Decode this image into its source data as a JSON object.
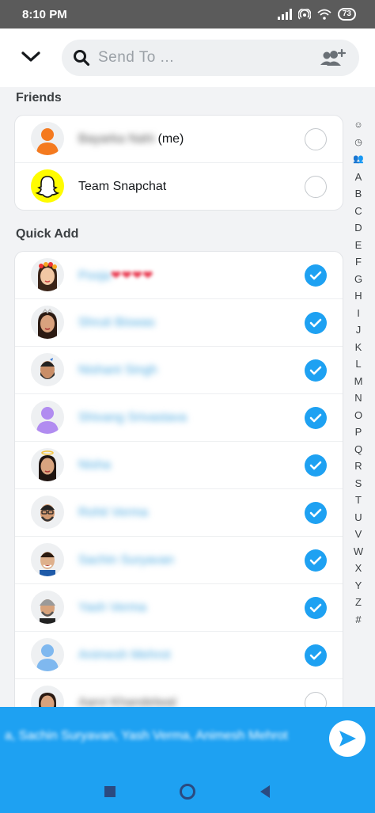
{
  "status_bar": {
    "time": "8:10 PM",
    "battery": "73"
  },
  "header": {
    "search_placeholder": "Send To ..."
  },
  "friends": {
    "title": "Friends",
    "items": [
      {
        "name": "Bayarka Nahi",
        "suffix": "(me)",
        "blurred": true,
        "checked": false,
        "avatar": "orange-silhouette"
      },
      {
        "name": "Team Snapchat",
        "suffix": "",
        "blurred": false,
        "checked": false,
        "avatar": "snapchat-logo"
      }
    ]
  },
  "quick_add": {
    "title": "Quick Add",
    "items": [
      {
        "name": "Pooja",
        "decoration": "❤❤❤❤",
        "checked": true,
        "avatar": "bitmoji-girl-flower-crown"
      },
      {
        "name": "Shruti Biswas",
        "checked": true,
        "avatar": "bitmoji-girl-tiara"
      },
      {
        "name": "Nishant Singh",
        "checked": true,
        "avatar": "bitmoji-boy-beard"
      },
      {
        "name": "Shivang Srivastava",
        "checked": true,
        "avatar": "purple-silhouette"
      },
      {
        "name": "Nisha",
        "checked": true,
        "avatar": "bitmoji-girl-halo"
      },
      {
        "name": "Rohit Verma",
        "checked": true,
        "avatar": "bitmoji-boy-glasses"
      },
      {
        "name": "Sachin Suryavan",
        "checked": true,
        "avatar": "bitmoji-boy-smile"
      },
      {
        "name": "Yash Verma",
        "checked": true,
        "avatar": "bitmoji-boy-grey-hair"
      },
      {
        "name": "Animesh Mehrot",
        "checked": true,
        "avatar": "blue-silhouette"
      },
      {
        "name": "Aarvi Khandelwal",
        "checked": false,
        "avatar": "bitmoji-girl-dark-hair"
      }
    ]
  },
  "index_bar": [
    "☺",
    "◷",
    "👥",
    "A",
    "B",
    "C",
    "D",
    "E",
    "F",
    "G",
    "H",
    "I",
    "J",
    "K",
    "L",
    "M",
    "N",
    "O",
    "P",
    "Q",
    "R",
    "S",
    "T",
    "U",
    "V",
    "W",
    "X",
    "Y",
    "Z",
    "#"
  ],
  "send_bar": {
    "recipients": "a, Sachin Suryavan, Yash Verma, Animesh Mehrot"
  },
  "colors": {
    "accent": "#1ea1f2",
    "snapchat_yellow": "#fffc00"
  }
}
